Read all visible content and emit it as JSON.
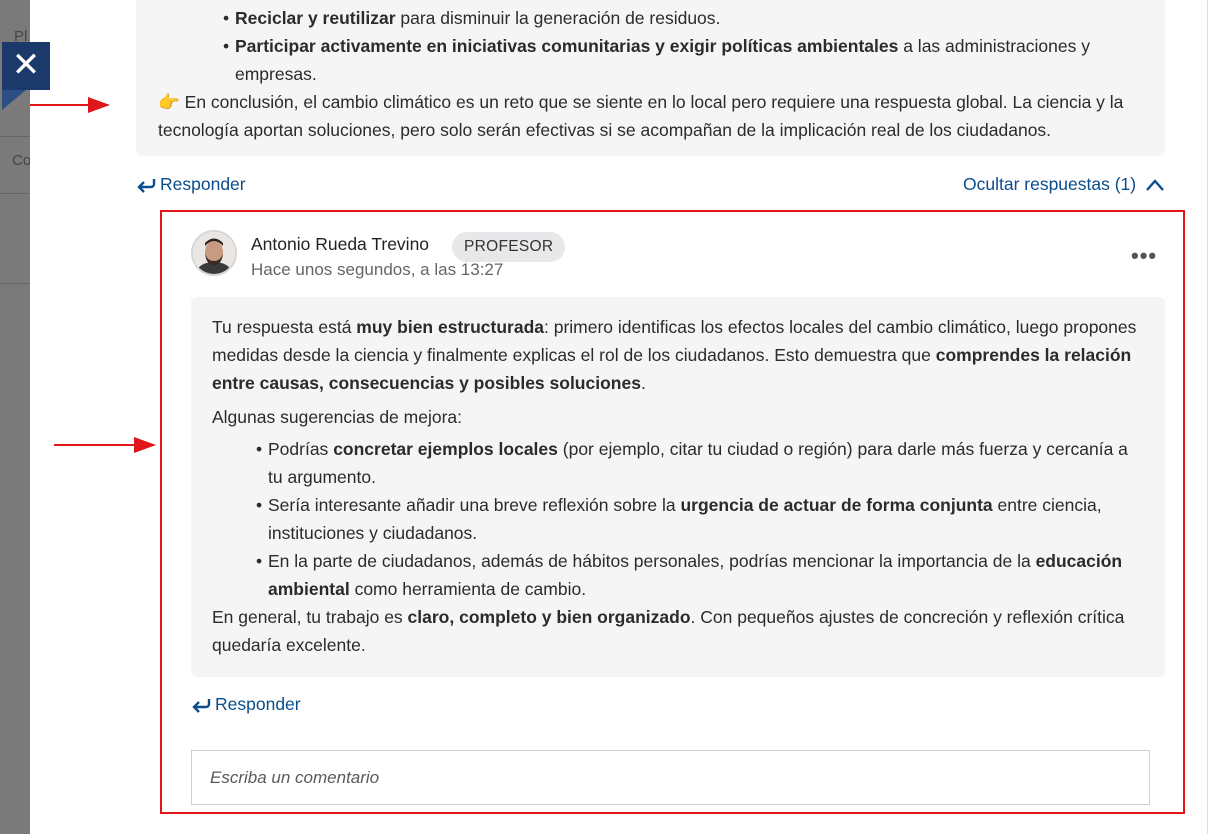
{
  "background": {
    "ghost_text_1": "Pl",
    "ghost_text_2": "Co"
  },
  "close_button": {
    "icon": "close-icon",
    "glyph": "✕"
  },
  "post": {
    "bullets": [
      {
        "bold": "Reciclar y reutilizar",
        "rest": " para disminuir la generación de residuos."
      },
      {
        "bold": "Participar activamente en iniciativas comunitarias y exigir políticas ambientales",
        "rest": " a las administraciones y empresas."
      }
    ],
    "conclusion_emoji": "👉",
    "conclusion_text": " En conclusión, el cambio climático es un reto que se siente en lo local pero requiere una respuesta global. La ciencia y la tecnología aportan soluciones, pero solo serán efectivas si se acompañan de la implicación real de los ciudadanos."
  },
  "actions": {
    "reply_label": "Responder",
    "hide_replies_label": "Ocultar respuestas (1)"
  },
  "comment": {
    "author": "Antonio Rueda Trevino",
    "role_badge": "PROFESOR",
    "timestamp": "Hace unos segundos, a las 13:27",
    "more_glyph": "•••",
    "p1": {
      "a": "Tu respuesta está ",
      "b": "muy bien estructurada",
      "c": ": primero identificas los efectos locales del cambio climático, luego propones medidas desde la ciencia y finalmente explicas el rol de los ciudadanos. Esto demuestra que ",
      "d": "comprendes la relación entre causas, consecuencias y posibles soluciones",
      "e": "."
    },
    "suggestions_intro": "Algunas sugerencias de mejora:",
    "suggestions": [
      {
        "a": "Podrías ",
        "b": "concretar ejemplos locales",
        "c": " (por ejemplo, citar tu ciudad o región) para darle más fuerza y cercanía a tu argumento."
      },
      {
        "a": "Sería interesante añadir una breve reflexión sobre la ",
        "b": "urgencia de actuar de forma conjunta",
        "c": " entre ciencia, instituciones y ciudadanos."
      },
      {
        "a": "En la parte de ciudadanos, además de hábitos personales, podrías mencionar la importancia de la ",
        "b": "educación ambiental",
        "c": " como herramienta de cambio."
      }
    ],
    "closing": {
      "a": "En general, tu trabajo es ",
      "b": "claro, completo y bien organizado",
      "c": ". Con pequeños ajustes de concreción y reflexión crítica quedaría excelente."
    },
    "reply_label": "Responder",
    "input_placeholder": "Escriba un comentario"
  },
  "colors": {
    "link": "#0a4d8c",
    "annotation": "#e0161b",
    "close_bg": "#1b3a6b"
  }
}
